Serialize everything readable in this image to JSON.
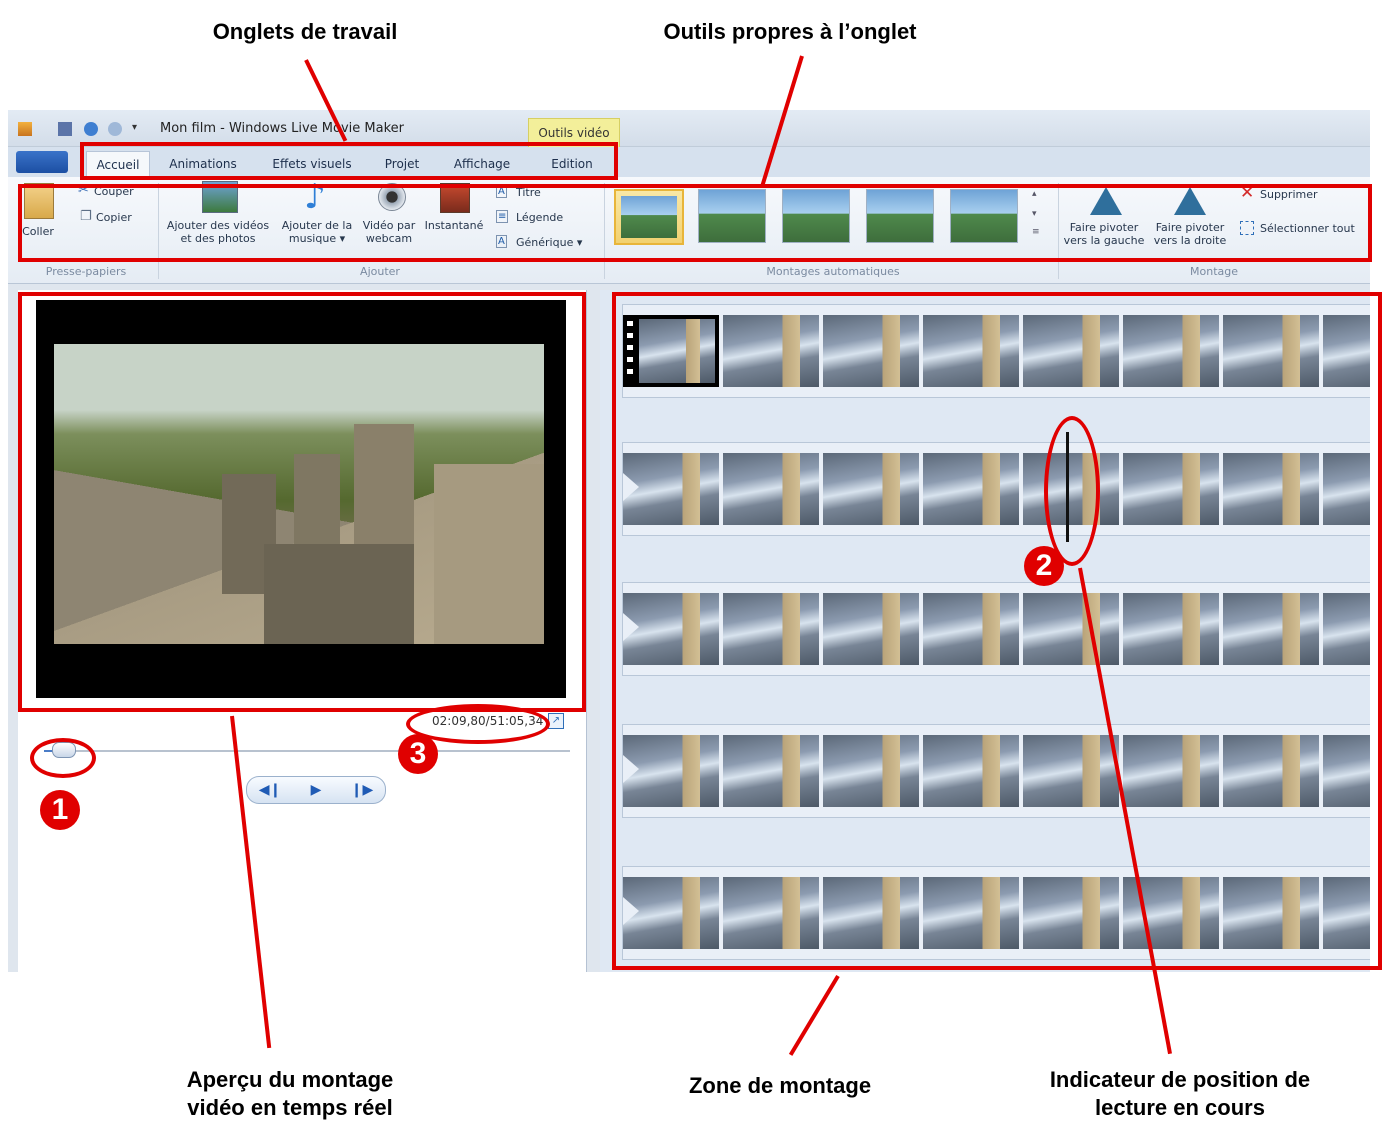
{
  "annotations": {
    "tabs_label": "Onglets de travail",
    "tools_label": "Outils propres à l’onglet",
    "preview_label_line1": "Aperçu du montage",
    "preview_label_line2": "vidéo en temps réel",
    "editing_zone_label": "Zone de montage",
    "position_label_line1": "Indicateur de position de",
    "position_label_line2": "lecture en cours",
    "badge1": "1",
    "badge2": "2",
    "badge3": "3"
  },
  "window": {
    "title": "Mon film - Windows Live Movie Maker",
    "context_tab": "Outils vidéo"
  },
  "tabs": [
    "Accueil",
    "Animations",
    "Effets visuels",
    "Projet",
    "Affichage",
    "Edition"
  ],
  "ribbon": {
    "clipboard": {
      "paste": "Coller",
      "cut": "Couper",
      "copy": "Copier",
      "group": "Presse-papiers"
    },
    "add": {
      "add_videos_1": "Ajouter des vidéos",
      "add_videos_2": "et des photos",
      "add_music_1": "Ajouter de la",
      "add_music_2": "musique ▾",
      "webcam_1": "Vidéo par",
      "webcam_2": "webcam",
      "snapshot": "Instantané",
      "title": "Titre",
      "caption": "Légende",
      "credits": "Générique ▾",
      "group": "Ajouter"
    },
    "automovie": {
      "group": "Montages automatiques"
    },
    "edit": {
      "rotate_left_1": "Faire pivoter",
      "rotate_left_2": "vers la gauche",
      "rotate_right_1": "Faire pivoter",
      "rotate_right_2": "vers la droite",
      "delete": "Supprimer",
      "select_all": "Sélectionner tout",
      "group": "Montage"
    }
  },
  "player": {
    "timecode": "02:09,80/51:05,34",
    "progress": 0.04
  },
  "colors": {
    "annotation_red": "#e00000",
    "accent_blue": "#1f5bb5",
    "context_tab_yellow": "#f3ef9a"
  }
}
